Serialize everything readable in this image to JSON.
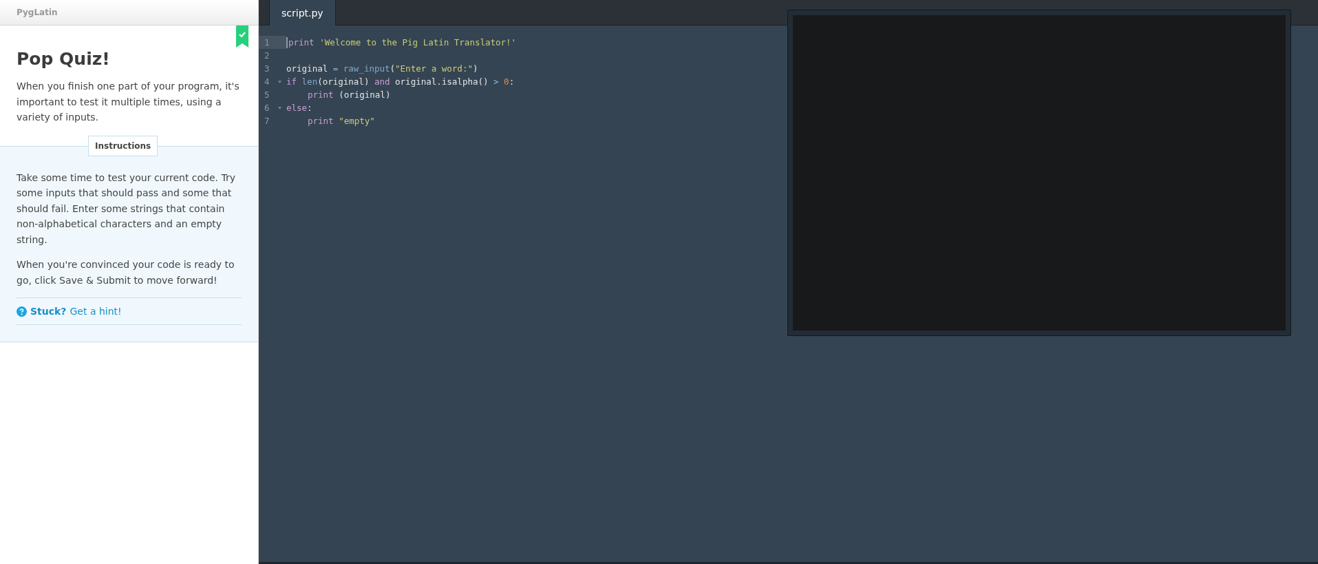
{
  "sidebar": {
    "project_title": "PygLatin",
    "completed": true,
    "title": "Pop Quiz!",
    "intro": "When you finish one part of your program, it's important to test it multiple times, using a variety of inputs.",
    "instructions_label": "Instructions",
    "instructions": [
      "Take some time to test your current code. Try some inputs that should pass and some that should fail. Enter some strings that contain non-alphabetical characters and an empty string.",
      "When you're convinced your code is ready to go, click Save & Submit to move forward!"
    ],
    "hint": {
      "label": "Stuck?",
      "link": "Get a hint!"
    }
  },
  "editor": {
    "tabs": [
      {
        "label": "script.py",
        "selected": true
      }
    ],
    "lines": [
      {
        "number": "1",
        "active": true,
        "foldable": false,
        "indent": false,
        "tokens": [
          {
            "kind": "keyword",
            "text": "print "
          },
          {
            "kind": "string",
            "text": "'Welcome to the Pig Latin Translator!'"
          }
        ]
      },
      {
        "number": "2",
        "active": false,
        "foldable": false
      },
      {
        "number": "3",
        "active": false,
        "foldable": false,
        "indent": false,
        "tokens": [
          {
            "kind": "plain",
            "text": "original "
          },
          {
            "kind": "operator",
            "text": "= "
          },
          {
            "kind": "builtin",
            "text": "raw_input"
          },
          {
            "kind": "plain",
            "text": "("
          },
          {
            "kind": "string",
            "text": "\"Enter a word:\""
          },
          {
            "kind": "plain",
            "text": ")"
          }
        ]
      },
      {
        "number": "4",
        "active": false,
        "foldable": true,
        "indent": false,
        "tokens": [
          {
            "kind": "keyword",
            "text": "if "
          },
          {
            "kind": "builtin",
            "text": "len"
          },
          {
            "kind": "plain",
            "text": "(original) "
          },
          {
            "kind": "keyword",
            "text": "and"
          },
          {
            "kind": "plain",
            "text": " original.isalpha() "
          },
          {
            "kind": "operator",
            "text": "> "
          },
          {
            "kind": "number",
            "text": "0"
          },
          {
            "kind": "plain",
            "text": ":"
          }
        ]
      },
      {
        "number": "5",
        "active": false,
        "foldable": false,
        "indent": true,
        "tokens": [
          {
            "kind": "keyword",
            "text": "print"
          },
          {
            "kind": "plain",
            "text": " (original)"
          }
        ]
      },
      {
        "number": "6",
        "active": false,
        "foldable": true,
        "indent": false,
        "tokens": [
          {
            "kind": "keyword",
            "text": "else"
          },
          {
            "kind": "plain",
            "text": ":"
          }
        ]
      },
      {
        "number": "7",
        "active": false,
        "foldable": false,
        "indent": true,
        "tokens": [
          {
            "kind": "keyword",
            "text": "print "
          },
          {
            "kind": "string",
            "text": "\"empty\""
          }
        ]
      }
    ]
  }
}
